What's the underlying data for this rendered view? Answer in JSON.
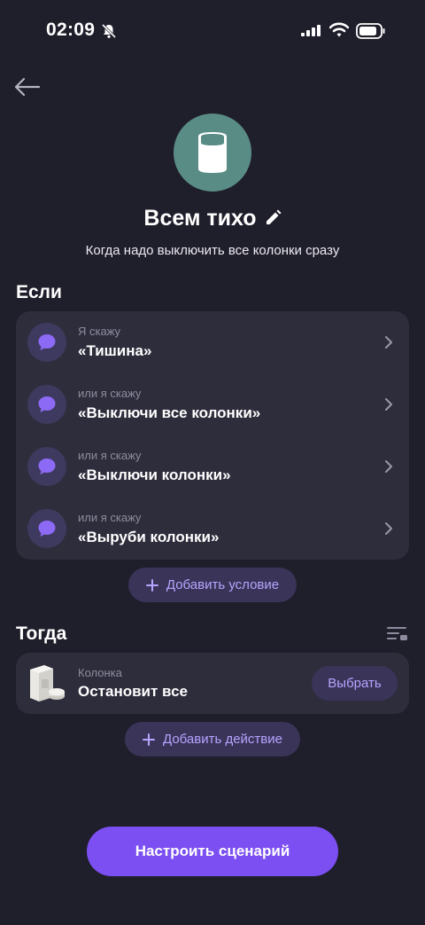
{
  "status_bar": {
    "time": "02:09"
  },
  "scenario": {
    "title": "Всем тихо",
    "description": "Когда надо выключить все колонки сразу"
  },
  "if_section": {
    "title": "Если",
    "conditions": [
      {
        "hint": "Я скажу",
        "phrase": "«Тишина»"
      },
      {
        "hint": "или я скажу",
        "phrase": "«Выключи все колонки»"
      },
      {
        "hint": "или я скажу",
        "phrase": "«Выключи колонки»"
      },
      {
        "hint": "или я скажу",
        "phrase": "«Выруби колонки»"
      }
    ],
    "add_label": "Добавить условие"
  },
  "then_section": {
    "title": "Тогда",
    "actions": [
      {
        "hint": "Колонка",
        "label": "Остановит все",
        "button": "Выбрать"
      }
    ],
    "add_label": "Добавить действие"
  },
  "footer": {
    "primary_label": "Настроить сценарий"
  },
  "icons": {
    "status": [
      "bell-off-icon",
      "signal-icon",
      "wifi-icon",
      "battery-icon"
    ],
    "back": "arrow-left-icon",
    "hero": "speaker-icon",
    "edit": "pencil-icon",
    "condition": "chat-bubble-icon",
    "chevron": "chevron-right-icon",
    "add": "plus-icon",
    "filter": "filter-list-icon",
    "device": "speaker-device-image"
  },
  "colors": {
    "background": "#1f1e2b",
    "card": "#2e2d3c",
    "accent": "#7b4ff2",
    "accent_text": "#b7a4ff",
    "secondary_button": "#3a3459",
    "hero_circle": "#5a8c86"
  }
}
